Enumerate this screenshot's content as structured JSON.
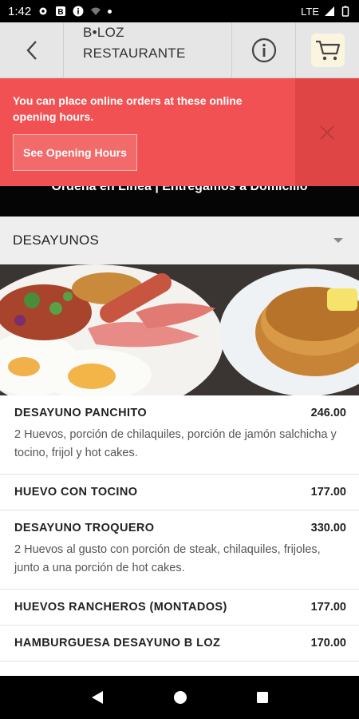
{
  "status_bar": {
    "time": "1:42",
    "network": "LTE"
  },
  "header": {
    "title_line1": "B•LOZ",
    "title_line2": "RESTAURANTE"
  },
  "notice": {
    "message": "You can place online orders at these online opening hours.",
    "button_label": "See Opening Hours"
  },
  "promo_text": "Ordena en Línea | Entregamos a Domicilio",
  "category": {
    "title": "DESAYUNOS"
  },
  "menu_items": [
    {
      "name": "DESAYUNO PANCHITO",
      "price": "246.00",
      "description": "2 Huevos, porción de chilaquiles, porción de jamón salchicha y tocino, frijol y hot cakes."
    },
    {
      "name": "HUEVO CON TOCINO",
      "price": "177.00",
      "description": ""
    },
    {
      "name": "DESAYUNO TROQUERO",
      "price": "330.00",
      "description": "2 Huevos al gusto con porción de steak, chilaquiles, frijoles, junto a una porción de hot cakes."
    },
    {
      "name": "HUEVOS RANCHEROS (MONTADOS)",
      "price": "177.00",
      "description": ""
    },
    {
      "name": "HAMBURGUESA DESAYUNO B LOZ",
      "price": "170.00",
      "description": ""
    }
  ],
  "colors": {
    "notice_bg": "#f15152",
    "header_bg": "#e6e6e6",
    "category_bg": "#eeeeee"
  },
  "icons": [
    "back-arrow-icon",
    "info-icon",
    "cart-icon",
    "close-icon",
    "chevron-down-icon"
  ]
}
